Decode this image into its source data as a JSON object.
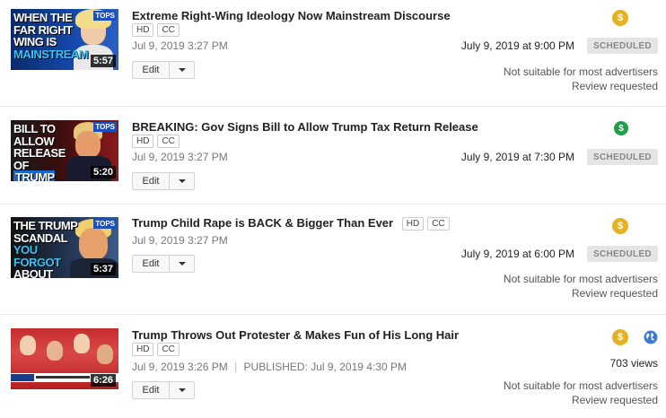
{
  "videos": [
    {
      "thumb_text": [
        "WHEN THE",
        "FAR RIGHT",
        "WING IS",
        "MAINSTREAM"
      ],
      "duration": "5:57",
      "tag": "TOPS",
      "title": "Extreme Right-Wing Ideology Now Mainstream Discourse",
      "badges": [
        "HD",
        "CC"
      ],
      "date": "Jul 9, 2019 3:27 PM",
      "edit_label": "Edit",
      "scheduled_time": "July 9, 2019 at 9:00 PM",
      "status": "SCHEDULED",
      "monetization": "yellow",
      "notice": [
        "Not suitable for most advertisers",
        "Review requested"
      ]
    },
    {
      "thumb_text": [
        "BILL TO",
        "ALLOW",
        "RELEASE OF",
        "TRUMP TAXES"
      ],
      "duration": "5:20",
      "tag": "TOPS",
      "title": "BREAKING: Gov Signs Bill to Allow Trump Tax Return Release",
      "badges": [
        "HD",
        "CC"
      ],
      "date": "Jul 9, 2019 3:27 PM",
      "edit_label": "Edit",
      "scheduled_time": "July 9, 2019 at 7:30 PM",
      "status": "SCHEDULED",
      "monetization": "green"
    },
    {
      "thumb_text": [
        "THE TRUMP",
        "SCANDAL",
        "YOU FORGOT",
        "ABOUT"
      ],
      "duration": "5:37",
      "tag": "TOPS",
      "title": "Trump Child Rape is BACK & Bigger Than Ever",
      "badges": [
        "HD",
        "CC"
      ],
      "date": "Jul 9, 2019 3:27 PM",
      "edit_label": "Edit",
      "scheduled_time": "July 9, 2019 at 6:00 PM",
      "status": "SCHEDULED",
      "monetization": "yellow",
      "notice": [
        "Not suitable for most advertisers",
        "Review requested"
      ]
    },
    {
      "duration": "6:26",
      "title": "Trump Throws Out Protester & Makes Fun of His Long Hair",
      "badges": [
        "HD",
        "CC"
      ],
      "date": "Jul 9, 2019 3:26 PM",
      "published": "PUBLISHED: Jul 9, 2019 4:30 PM",
      "edit_label": "Edit",
      "views": "703 views",
      "monetization": "yellow",
      "visibility_icon": "globe-icon",
      "notice": [
        "Not suitable for most advertisers",
        "Review requested"
      ]
    }
  ],
  "colors": {
    "monet_yellow": "#e6b221",
    "monet_green": "#1e9e4a",
    "globe_blue": "#3d7bd9"
  },
  "icons": {
    "monetization": "dollar-icon",
    "dropdown": "caret-down-icon",
    "visibility": "globe-icon"
  }
}
